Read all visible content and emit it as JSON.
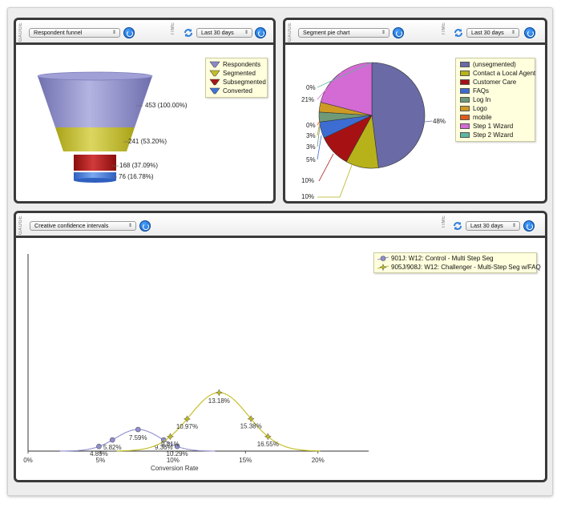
{
  "panels": {
    "funnel": {
      "gauge_label": "GAUGE",
      "gauge_value": "Respondent funnel",
      "time_label": "TIME",
      "time_value": "Last 30 days",
      "legend": [
        "Respondents",
        "Segmented",
        "Subsegmented",
        "Converted"
      ],
      "values": [
        "453 (100.00%)",
        "241 (53.20%)",
        "168 (37.09%)",
        "76 (16.78%)"
      ]
    },
    "pie": {
      "gauge_label": "GAUGE",
      "gauge_value": "Segment pie chart",
      "time_label": "TIME",
      "time_value": "Last 30 days",
      "legend": [
        {
          "label": "(unsegmented)",
          "color": "#6a6aa6"
        },
        {
          "label": "Contact a Local Agent",
          "color": "#b8b21a"
        },
        {
          "label": "Customer Care",
          "color": "#a61214"
        },
        {
          "label": "FAQs",
          "color": "#3d6dd2"
        },
        {
          "label": "Log In",
          "color": "#6e9a78"
        },
        {
          "label": "Logo",
          "color": "#cf9a24"
        },
        {
          "label": "mobile",
          "color": "#e05a18"
        },
        {
          "label": "Step 1 Wizard",
          "color": "#d46ad4"
        },
        {
          "label": "Step 2 Wizard",
          "color": "#5cb8a0"
        }
      ],
      "slice_labels": [
        "48%",
        "10%",
        "10%",
        "5%",
        "3%",
        "3%",
        "0%",
        "21%",
        "0%"
      ]
    },
    "confidence": {
      "gauge_label": "GAUGE",
      "gauge_value": "Creative confidence intervals",
      "time_label": "TIME",
      "time_value": "Last 30 days",
      "legend": [
        "901J: W12: Control - Multi Step Seg",
        "905J/908J: W12: Challenger - Multi-Step Seg w/FAQ"
      ],
      "x_title": "Conversion Rate",
      "x_ticks": [
        "0%",
        "5%",
        "10%",
        "15%",
        "20%"
      ]
    }
  },
  "chart_data": [
    {
      "type": "funnel",
      "categories": [
        "Respondents",
        "Segmented",
        "Subsegmented",
        "Converted"
      ],
      "values": [
        453,
        241,
        168,
        76
      ],
      "percents": [
        100.0,
        53.2,
        37.09,
        16.78
      ],
      "colors": [
        "#8a8ac8",
        "#c4bd2a",
        "#a51616",
        "#3f74d6"
      ]
    },
    {
      "type": "pie",
      "categories": [
        "(unsegmented)",
        "Contact a Local Agent",
        "Customer Care",
        "FAQs",
        "Log In",
        "Logo",
        "mobile",
        "Step 1 Wizard",
        "Step 2 Wizard"
      ],
      "values": [
        48,
        10,
        10,
        5,
        3,
        3,
        0,
        21,
        0
      ],
      "colors": [
        "#6a6aa6",
        "#b8b21a",
        "#a61214",
        "#3d6dd2",
        "#6e9a78",
        "#cf9a24",
        "#e05a18",
        "#d46ad4",
        "#5cb8a0"
      ]
    },
    {
      "type": "line",
      "xlabel": "Conversion Rate",
      "xlim": [
        0,
        0.235
      ],
      "series": [
        {
          "name": "901J: W12: Control - Multi Step Seg",
          "color": "#8f8fd0",
          "mean": 0.0759,
          "sd": 0.0154,
          "points": [
            {
              "x": 0.0489,
              "label": "4.89%"
            },
            {
              "x": 0.0582,
              "label": "5.82%"
            },
            {
              "x": 0.0759,
              "label": "7.59%"
            },
            {
              "x": 0.0936,
              "label": "9.36%"
            },
            {
              "x": 0.1029,
              "label": "10.29%"
            }
          ]
        },
        {
          "name": "905J/908J: W12: Challenger - Multi-Step Seg w/FAQ",
          "color": "#c2bb1c",
          "mean": 0.1318,
          "sd": 0.0202,
          "points": [
            {
              "x": 0.0981,
              "label": "9.81%"
            },
            {
              "x": 0.1097,
              "label": "10.97%"
            },
            {
              "x": 0.1318,
              "label": "13.18%"
            },
            {
              "x": 0.1538,
              "label": "15.38%"
            },
            {
              "x": 0.1655,
              "label": "16.55%"
            }
          ]
        }
      ]
    }
  ]
}
